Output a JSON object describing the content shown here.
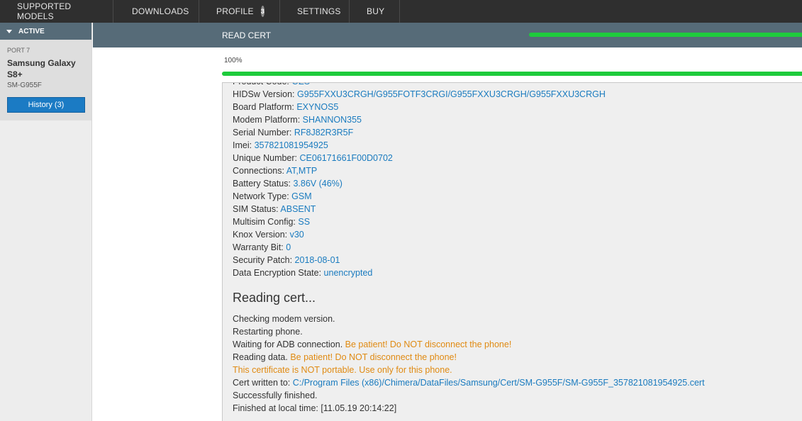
{
  "nav": {
    "items": [
      {
        "label": "SUPPORTED MODELS"
      },
      {
        "label": "DOWNLOADS"
      },
      {
        "label": "PROFILE",
        "badge": "3"
      },
      {
        "label": "SETTINGS"
      },
      {
        "label": "BUY"
      }
    ]
  },
  "sidebar": {
    "active_label": "ACTIVE",
    "port": "PORT 7",
    "model_name": "Samsung Galaxy S8+",
    "model_code": "SM-G955F",
    "history_button": "History (3)"
  },
  "header": {
    "title": "READ CERT",
    "progress": 1.0
  },
  "progress": {
    "percent_text": "100%",
    "value": 1.0
  },
  "log": {
    "info": [
      {
        "key": "Product Code: ",
        "value": "OZS"
      },
      {
        "key": "HIDSw Version: ",
        "value": "G955FXXU3CRGH/G955FOTF3CRGI/G955FXXU3CRGH/G955FXXU3CRGH"
      },
      {
        "key": "Board Platform: ",
        "value": "EXYNOS5"
      },
      {
        "key": "Modem Platform: ",
        "value": "SHANNON355"
      },
      {
        "key": "Serial Number: ",
        "value": "RF8J82R3R5F"
      },
      {
        "key": "Imei: ",
        "value": "357821081954925"
      },
      {
        "key": "Unique Number: ",
        "value": "CE06171661F00D0702"
      },
      {
        "key": "Connections: ",
        "value": "AT,MTP"
      },
      {
        "key": "Battery Status: ",
        "value": "3.86V (46%)"
      },
      {
        "key": "Network Type: ",
        "value": "GSM"
      },
      {
        "key": "SIM Status: ",
        "value": "ABSENT"
      },
      {
        "key": "Multisim Config: ",
        "value": "SS"
      },
      {
        "key": "Knox Version: ",
        "value": "v30"
      },
      {
        "key": "Warranty Bit: ",
        "value": "0"
      },
      {
        "key": "Security Patch: ",
        "value": "2018-08-01"
      },
      {
        "key": "Data Encryption State: ",
        "value": "unencrypted"
      }
    ],
    "section_title": "Reading cert...",
    "steps": {
      "checking_modem": "Checking modem version.",
      "restarting": "Restarting phone.",
      "waiting_adb": "Waiting for ADB connection. ",
      "waiting_adb_warn": "Be patient! Do NOT disconnect the phone!",
      "reading_data": "Reading data. ",
      "reading_data_warn": "Be patient! Do NOT disconnect the phone!",
      "not_portable_warn": "This certificate is NOT portable. Use only for this phone.",
      "cert_written": "Cert written to: ",
      "cert_path": "C:/Program Files (x86)/Chimera/DataFiles/Samsung/Cert/SM-G955F/SM-G955F_357821081954925.cert",
      "success": "Successfully finished.",
      "finished_at": "Finished at local time: [11.05.19 20:14:22]"
    }
  }
}
